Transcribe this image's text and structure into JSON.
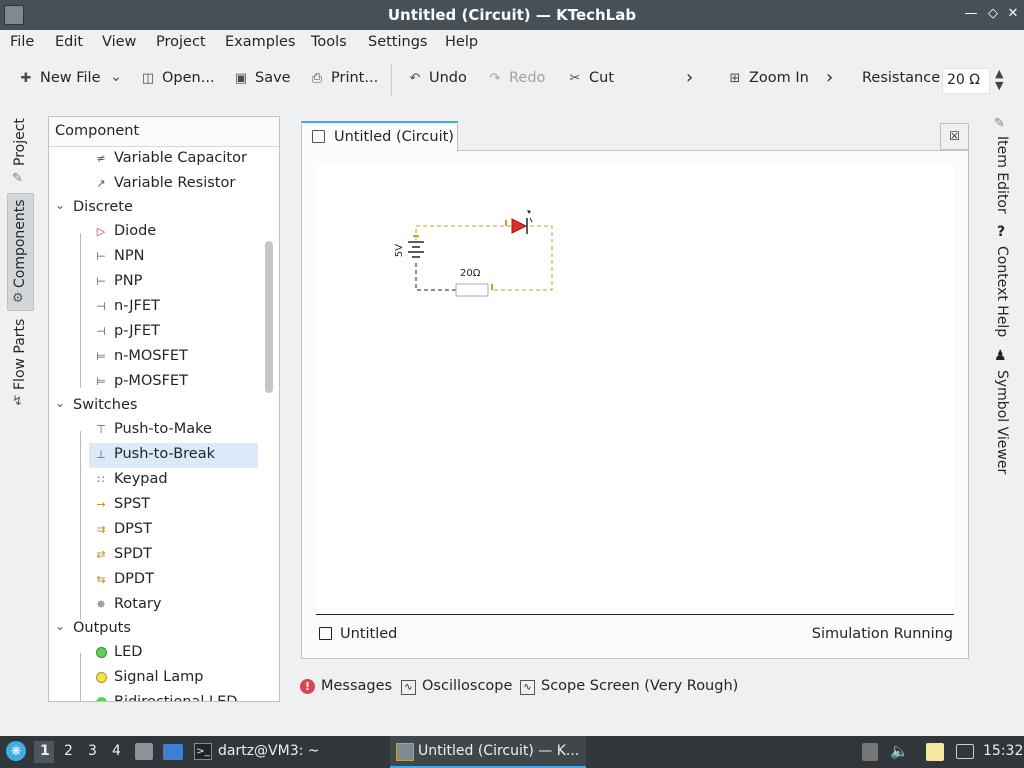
{
  "window": {
    "title": "Untitled (Circuit) — KTechLab"
  },
  "menubar": [
    "File",
    "Edit",
    "View",
    "Project",
    "Examples",
    "Tools",
    "Settings",
    "Help"
  ],
  "toolbar": {
    "new_file": "New File",
    "open": "Open...",
    "save": "Save",
    "print": "Print...",
    "undo": "Undo",
    "redo": "Redo",
    "cut": "Cut",
    "zoom_in": "Zoom In",
    "resistance_label": "Resistance",
    "resistance_value": "20 Ω"
  },
  "left_dock_tabs": [
    "Project",
    "Components",
    "Flow Parts"
  ],
  "component_panel": {
    "header": "Component",
    "items": {
      "variable_capacitor": "Variable Capacitor",
      "variable_resistor": "Variable Resistor",
      "discrete": "Discrete",
      "diode": "Diode",
      "npn": "NPN",
      "pnp": "PNP",
      "n_jfet": "n-JFET",
      "p_jfet": "p-JFET",
      "n_mosfet": "n-MOSFET",
      "p_mosfet": "p-MOSFET",
      "switches": "Switches",
      "push_to_make": "Push-to-Make",
      "push_to_break": "Push-to-Break",
      "keypad": "Keypad",
      "spst": "SPST",
      "dpst": "DPST",
      "spdt": "SPDT",
      "dpdt": "DPDT",
      "rotary": "Rotary",
      "outputs": "Outputs",
      "led": "LED",
      "signal_lamp": "Signal Lamp",
      "bidirectional_led": "Bidirectional LED"
    },
    "selected": "Push-to-Break"
  },
  "document": {
    "tab_label": "Untitled (Circuit)",
    "status_left": "Untitled",
    "status_right": "Simulation Running",
    "circuit": {
      "battery_label": "5V",
      "resistor_label": "20Ω",
      "wire_color": "#c8a020",
      "diode_color": "#e03030"
    }
  },
  "bottom_dock_tabs": {
    "messages": "Messages",
    "oscilloscope": "Oscilloscope",
    "scope_screen": "Scope Screen (Very Rough)"
  },
  "right_dock_tabs": [
    "Item Editor",
    "Context Help",
    "Symbol Viewer"
  ],
  "taskbar": {
    "desktops": [
      "1",
      "2",
      "3",
      "4"
    ],
    "terminal": "dartz@VM3: ~",
    "active_window": "Untitled (Circuit) — K...",
    "clock": "15:32"
  },
  "colors": {
    "accent": "#3daee9",
    "selection": "#daeaf8",
    "titlebar": "#475057",
    "taskbar": "#31363b"
  }
}
